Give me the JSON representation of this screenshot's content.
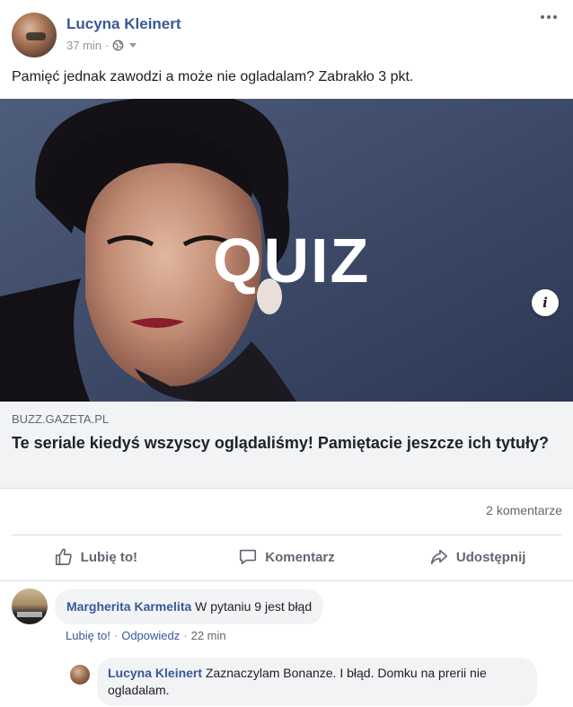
{
  "post": {
    "author": "Lucyna Kleinert",
    "time": "37 min",
    "text": "Pamięć jednak zawodzi a może nie ogladalam? Zabrakło 3 pkt.",
    "image_overlay_text": "QUIZ",
    "link_domain": "BUZZ.GAZETA.PL",
    "link_title": "Te seriale kiedyś wszyscy oglądaliśmy! Pamiętacie jeszcze ich tytuły?",
    "comment_count": "2 komentarze"
  },
  "actions": {
    "like": "Lubię to!",
    "comment": "Komentarz",
    "share": "Udostępnij"
  },
  "comments": [
    {
      "author": "Margherita Karmelita",
      "text": "W pytaniu 9 jest błąd",
      "like": "Lubię to!",
      "reply": "Odpowiedz",
      "time": "22 min"
    },
    {
      "author": "Lucyna Kleinert",
      "text": "Zaznaczylam Bonanze. I błąd. Domku na prerii nie ogladalam."
    }
  ],
  "icons": {
    "privacy": "globe-icon",
    "menu": "more-options-icon",
    "info": "info-icon",
    "like": "thumbs-up-icon",
    "comment": "comment-bubble-icon",
    "share": "share-arrow-icon"
  },
  "colors": {
    "link_blue": "#385898",
    "muted_text": "#606770",
    "bubble_bg": "#f2f3f5",
    "divider": "#dadde1"
  }
}
